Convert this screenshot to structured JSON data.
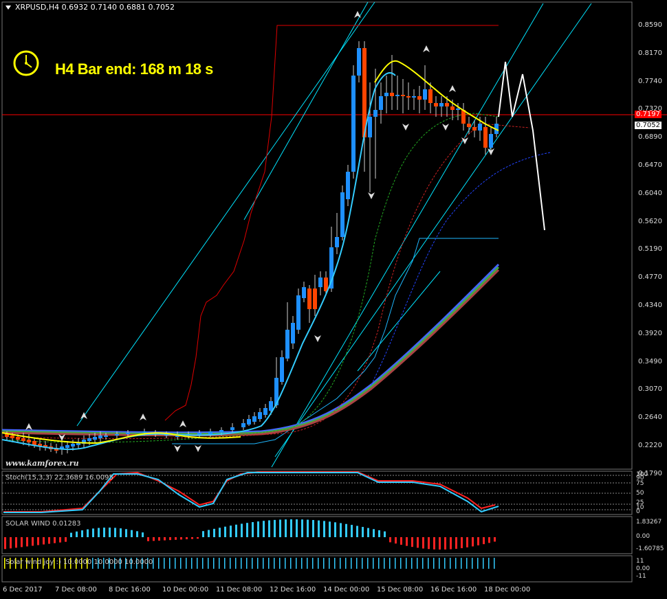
{
  "header": {
    "symbol_line": "XRPUSD,H4  0.6932 0.7140 0.6881 0.7052"
  },
  "overlay": {
    "bar_end_text": "H4 Bar end: 168 m 18 s",
    "watermark": "www.kamforex.ru"
  },
  "price_axis": {
    "labels": [
      "0.8590",
      "0.8170",
      "0.7740",
      "0.7320",
      "0.6890",
      "0.6470",
      "0.6040",
      "0.5620",
      "0.5190",
      "0.4770",
      "0.4340",
      "0.3920",
      "0.3490",
      "0.3070",
      "0.2640",
      "0.2220",
      "0.1790"
    ],
    "red_tag": "0.7197",
    "current_tag": "0.7052"
  },
  "time_axis": {
    "labels": [
      "6 Dec 2017",
      "7 Dec 08:00",
      "8 Dec 16:00",
      "10 Dec 00:00",
      "11 Dec 08:00",
      "12 Dec 16:00",
      "14 Dec 00:00",
      "15 Dec 08:00",
      "16 Dec 16:00",
      "18 Dec 00:00"
    ]
  },
  "stoch_panel": {
    "label": "Stoch(15,3,3) 22.3689 16.0095",
    "scale": [
      "100",
      "90",
      "75",
      "50",
      "25",
      "10",
      "0"
    ]
  },
  "solar_panel": {
    "label": "SOLAR WIND 0.01283",
    "scale": [
      "1.83267",
      "0.00",
      "-1.60785"
    ]
  },
  "joy_panel": {
    "label": "Solar wind joy :) 10.0000 10.0000 10.0000",
    "scale": [
      "11",
      "0.00",
      "-11"
    ]
  },
  "colors": {
    "bull": "#1e90ff",
    "bear": "#ff4500",
    "ma_fast": "#ffff00",
    "ma_cyan": "#33ccff",
    "channel": "#00e5ff",
    "resistance": "#ff0000"
  }
}
